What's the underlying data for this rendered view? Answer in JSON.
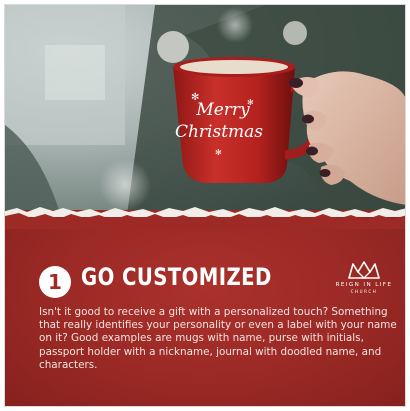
{
  "mug": {
    "text_line1": "Merry",
    "text_line2": "Christmas"
  },
  "item": {
    "number": "1",
    "title": "GO CUSTOMIZED",
    "description": "Isn't it good to receive a gift with a personalized touch? Something that really identifies your personality or even a label with your name on it? Good examples are mugs with name, purse with initials, passport holder with a nickname, journal with doodled name, and characters."
  },
  "logo": {
    "name": "REIGN IN LIFE",
    "subtitle": "CHURCH",
    "icon": "crown-icon"
  },
  "colors": {
    "panel_red": "#9c2a26",
    "mug_red": "#b8221f",
    "text_white": "#ffffff"
  }
}
